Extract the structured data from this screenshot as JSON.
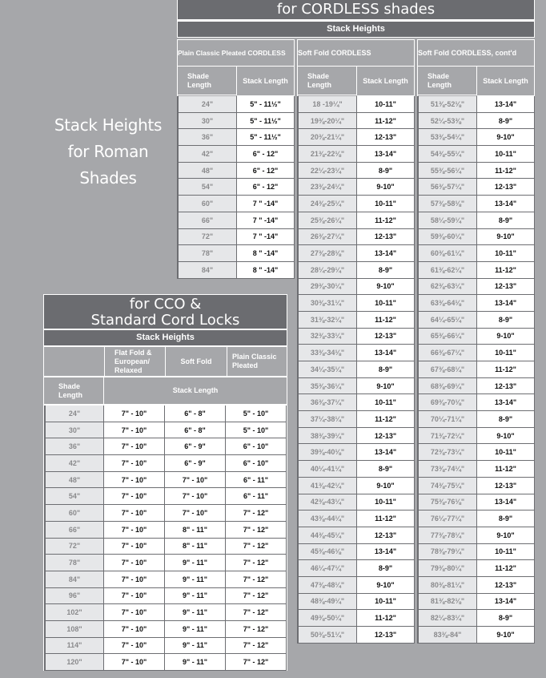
{
  "side_title": [
    "Stack Heights",
    "for Roman",
    "Shades"
  ],
  "cordless": {
    "title": "for CORDLESS shades",
    "subtitle": "Stack Heights",
    "groups": [
      "Plain Classic Pleated CORDLESS",
      "Soft Fold CORDLESS",
      "Soft Fold CORDLESS, cont'd"
    ],
    "col_shade": "Shade Length",
    "col_stack": "Stack Length",
    "plain_classic": [
      [
        "24\"",
        "5\" - 11½\""
      ],
      [
        "30\"",
        "5\" - 11½\""
      ],
      [
        "36\"",
        "5\" - 11½\""
      ],
      [
        "42\"",
        "6\" - 12\""
      ],
      [
        "48\"",
        "6\" - 12\""
      ],
      [
        "54\"",
        "6\" - 12\""
      ],
      [
        "60\"",
        "7 \" -14\""
      ],
      [
        "66\"",
        "7 \" -14\""
      ],
      [
        "72\"",
        "7 \" -14\""
      ],
      [
        "78\"",
        "8 \" -14\""
      ],
      [
        "84\"",
        "8 \" -14\""
      ]
    ],
    "soft_fold": [
      [
        "18 -19¼\"",
        "10-11\""
      ],
      [
        "19⅜-20¼\"",
        "11-12\""
      ],
      [
        "20⅜-21¼\"",
        "12-13\""
      ],
      [
        "21⅜-22⅛\"",
        "13-14\""
      ],
      [
        "22¼-23¼\"",
        "8-9\""
      ],
      [
        "23⅜-24¼\"",
        "9-10\""
      ],
      [
        "24⅜-25¼\"",
        "10-11\""
      ],
      [
        "25⅜-26¼\"",
        "11-12\""
      ],
      [
        "26⅜-27¼\"",
        "12-13\""
      ],
      [
        "27⅜-28⅛\"",
        "13-14\""
      ],
      [
        "28¼-29¼\"",
        "8-9\""
      ],
      [
        "29⅜-30¼\"",
        "9-10\""
      ],
      [
        "30⅜-31¼\"",
        "10-11\""
      ],
      [
        "31⅜-32¼\"",
        "11-12\""
      ],
      [
        "32⅜-33¼\"",
        "12-13\""
      ],
      [
        "33⅜-34⅛\"",
        "13-14\""
      ],
      [
        "34¼-35¼\"",
        "8-9\""
      ],
      [
        "35⅜-36¼\"",
        "9-10\""
      ],
      [
        "36⅜-37¼\"",
        "10-11\""
      ],
      [
        "37¼-38¼\"",
        "11-12\""
      ],
      [
        "38⅜-39¼\"",
        "12-13\""
      ],
      [
        "39⅜-40⅛\"",
        "13-14\""
      ],
      [
        "40¼-41¼\"",
        "8-9\""
      ],
      [
        "41⅜-42¼\"",
        "9-10\""
      ],
      [
        "42⅜-43¼\"",
        "10-11\""
      ],
      [
        "43⅜-44¼\"",
        "11-12\""
      ],
      [
        "44⅜-45¼\"",
        "12-13\""
      ],
      [
        "45⅜-46⅛\"",
        "13-14\""
      ],
      [
        "46¼-47¼\"",
        "8-9\""
      ],
      [
        "47⅜-48¼\"",
        "9-10\""
      ],
      [
        "48⅜-49¼\"",
        "10-11\""
      ],
      [
        "49⅜-50¼\"",
        "11-12\""
      ],
      [
        "50⅜-51¼\"",
        "12-13\""
      ]
    ],
    "soft_fold_contd": [
      [
        "51⅜-52⅛\"",
        "13-14\""
      ],
      [
        "52¼-53⅜\"",
        "8-9\""
      ],
      [
        "53⅜-54¼\"",
        "9-10\""
      ],
      [
        "54⅜-55¼\"",
        "10-11\""
      ],
      [
        "55⅜-56¼\"",
        "11-12\""
      ],
      [
        "56⅜-57¼\"",
        "12-13\""
      ],
      [
        "57⅜-58⅛\"",
        "13-14\""
      ],
      [
        "58¼-59¼\"",
        "8-9\""
      ],
      [
        "59⅜-60¼\"",
        "9-10\""
      ],
      [
        "60⅜-61¼\"",
        "10-11\""
      ],
      [
        "61⅜-62¼\"",
        "11-12\""
      ],
      [
        "62⅜-63¼\"",
        "12-13\""
      ],
      [
        "63⅜-64⅛\"",
        "13-14\""
      ],
      [
        "64¼-65¼\"",
        "8-9\""
      ],
      [
        "65⅜-66¼\"",
        "9-10\""
      ],
      [
        "66⅜-67¼\"",
        "10-11\""
      ],
      [
        "67⅜-68¼\"",
        "11-12\""
      ],
      [
        "68⅜-69¼\"",
        "12-13\""
      ],
      [
        "69⅜-70⅛\"",
        "13-14\""
      ],
      [
        "70¼-71¼\"",
        "8-9\""
      ],
      [
        "71⅜-72¼\"",
        "9-10\""
      ],
      [
        "72⅜-73¼\"",
        "10-11\""
      ],
      [
        "73⅜-74¼\"",
        "11-12\""
      ],
      [
        "74⅜-75¼\"",
        "12-13\""
      ],
      [
        "75⅜-76⅛\"",
        "13-14\""
      ],
      [
        "76¼-77¼\"",
        "8-9\""
      ],
      [
        "77⅜-78¼\"",
        "9-10\""
      ],
      [
        "78⅜-79¼\"",
        "10-11\""
      ],
      [
        "79⅜-80¼\"",
        "11-12\""
      ],
      [
        "80⅜-81¼\"",
        "12-13\""
      ],
      [
        "81⅜-82⅛\"",
        "13-14\""
      ],
      [
        "82¼-83¼\"",
        "8-9\""
      ],
      [
        "83⅜-84\"",
        "9-10\""
      ]
    ]
  },
  "cco": {
    "title_line1": "for CCO &",
    "title_line2": "Standard Cord Locks",
    "subtitle": "Stack Heights",
    "col_headers": [
      "Flat Fold & European/ Relaxed",
      "Soft Fold",
      "Plain Classic Pleated"
    ],
    "col_shade": "Shade Length",
    "col_stack": "Stack Length",
    "rows": [
      [
        "24\"",
        "7\" - 10\"",
        "6\" - 8\"",
        "5\" - 10\""
      ],
      [
        "30\"",
        "7\" - 10\"",
        "6\" - 8\"",
        "5\" - 10\""
      ],
      [
        "36\"",
        "7\" - 10\"",
        "6\" - 9\"",
        "6\" - 10\""
      ],
      [
        "42\"",
        "7\" - 10\"",
        "6\" - 9\"",
        "6\" - 10\""
      ],
      [
        "48\"",
        "7\" - 10\"",
        "7\" - 10\"",
        "6\" - 11\""
      ],
      [
        "54\"",
        "7\" - 10\"",
        "7\" - 10\"",
        "6\" - 11\""
      ],
      [
        "60\"",
        "7\" - 10\"",
        "7\" - 10\"",
        "7\" - 12\""
      ],
      [
        "66\"",
        "7\" - 10\"",
        "8\" - 11\"",
        "7\" - 12\""
      ],
      [
        "72\"",
        "7\" - 10\"",
        "8\" - 11\"",
        "7\" - 12\""
      ],
      [
        "78\"",
        "7\" - 10\"",
        "9\" - 11\"",
        "7\" - 12\""
      ],
      [
        "84\"",
        "7\" - 10\"",
        "9\" - 11\"",
        "7\" - 12\""
      ],
      [
        "96\"",
        "7\" - 10\"",
        "9\" - 11\"",
        "7\" - 12\""
      ],
      [
        "102\"",
        "7\" - 10\"",
        "9\" - 11\"",
        "7\" - 12\""
      ],
      [
        "108\"",
        "7\" - 10\"",
        "9\" - 11\"",
        "7\" - 12\""
      ],
      [
        "114\"",
        "7\" - 10\"",
        "9\" - 11\"",
        "7\" - 12\""
      ],
      [
        "120\"",
        "7\" - 10\"",
        "9\" - 11\"",
        "7\" - 12\""
      ]
    ]
  }
}
